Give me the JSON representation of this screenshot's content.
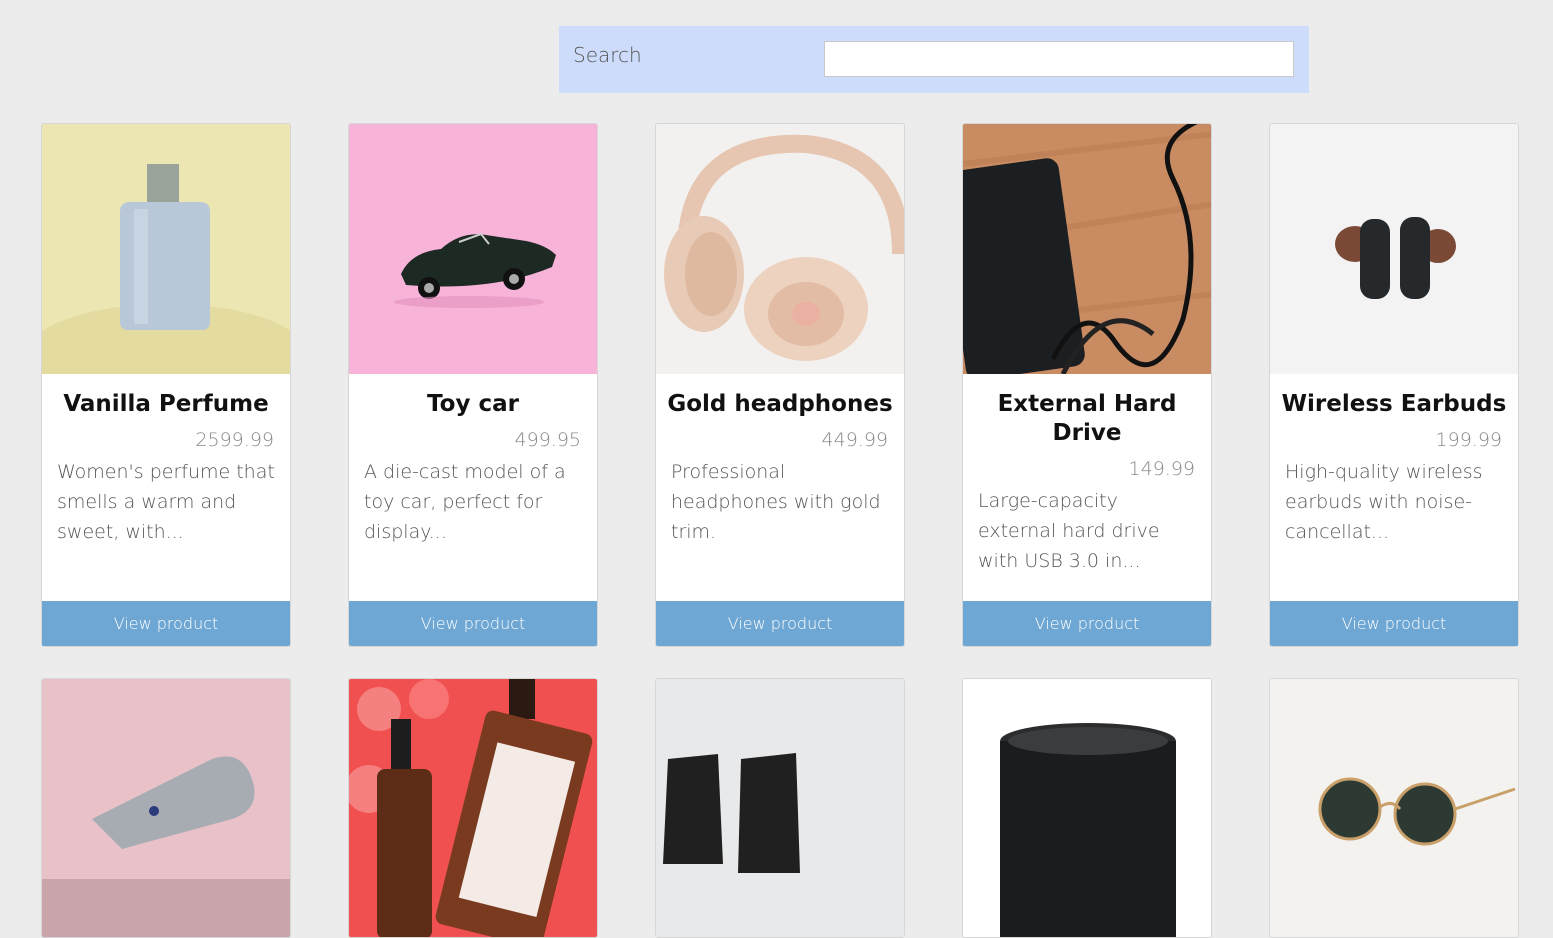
{
  "search": {
    "label": "Search",
    "value": "",
    "placeholder": ""
  },
  "products": [
    {
      "title": "Vanilla Perfume",
      "price": "2599.99",
      "description": "Women's perfume that smells a warm and sweet, with...",
      "button": "View product",
      "image": "perfume-bottle-image"
    },
    {
      "title": "Toy car",
      "price": "499.95",
      "description": "A die-cast model of a toy car, perfect for display...",
      "button": "View product",
      "image": "toy-car-image"
    },
    {
      "title": "Gold headphones",
      "price": "449.99",
      "description": "Professional headphones with gold trim.",
      "button": "View product",
      "image": "headphones-image"
    },
    {
      "title": "External Hard Drive",
      "price": "149.99",
      "description": "Large-capacity external hard drive with USB 3.0 in...",
      "button": "View product",
      "image": "hard-drive-image"
    },
    {
      "title": "Wireless Earbuds",
      "price": "199.99",
      "description": "High-quality wireless earbuds with noise-cancellat...",
      "button": "View product",
      "image": "earbuds-image"
    }
  ],
  "second_row_images": [
    "hair-dryer-image",
    "serum-bottles-image",
    "boots-image",
    "speaker-image",
    "sunglasses-image"
  ]
}
